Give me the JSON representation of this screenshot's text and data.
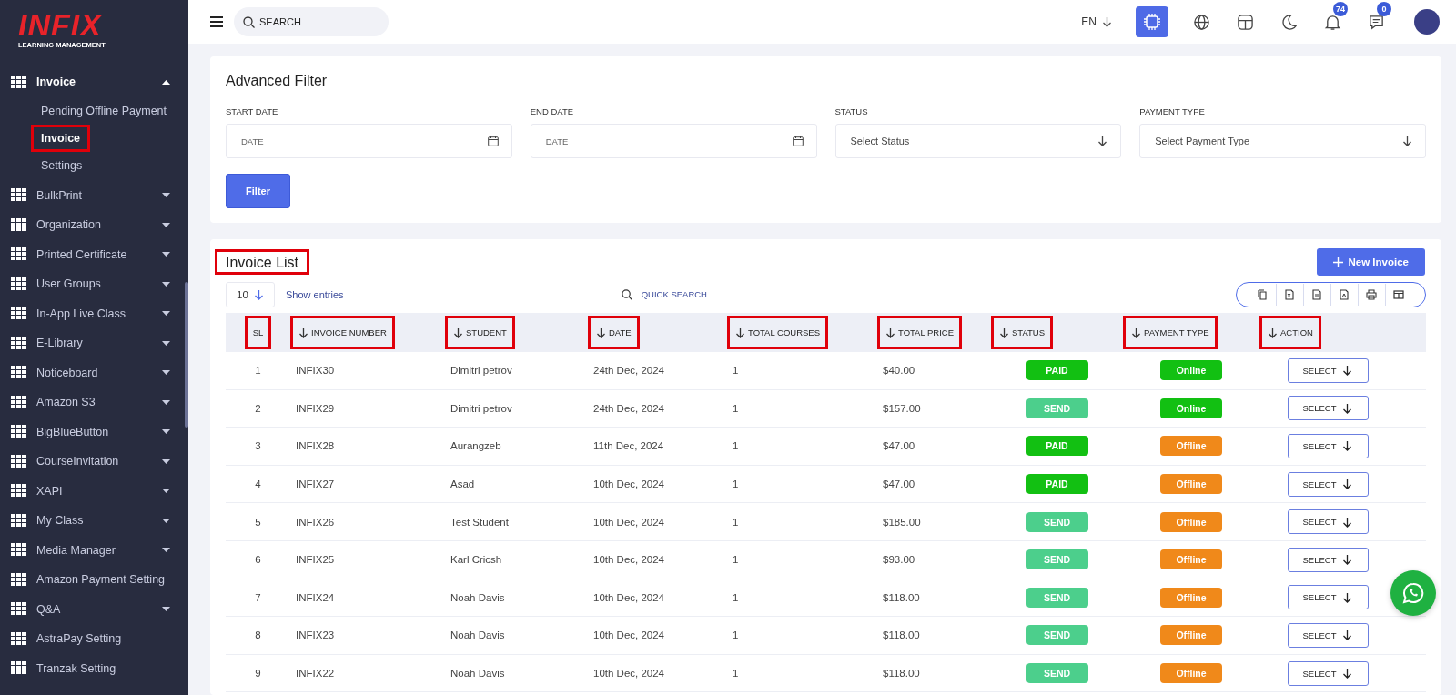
{
  "logo": {
    "name": "INFIX",
    "tagline": "LEARNING MANAGEMENT"
  },
  "sidebar": {
    "items": [
      {
        "label": "Invoice",
        "has_submenu": true,
        "expanded": true,
        "children": [
          {
            "label": "Pending Offline Payment",
            "selected": false,
            "highlighted": false
          },
          {
            "label": "Invoice",
            "selected": true,
            "highlighted": true
          },
          {
            "label": "Settings",
            "selected": false,
            "highlighted": false
          }
        ]
      },
      {
        "label": "BulkPrint",
        "has_submenu": true,
        "expanded": false
      },
      {
        "label": "Organization",
        "has_submenu": true,
        "expanded": false
      },
      {
        "label": "Printed Certificate",
        "has_submenu": true,
        "expanded": false
      },
      {
        "label": "User Groups",
        "has_submenu": true,
        "expanded": false
      },
      {
        "label": "In-App Live Class",
        "has_submenu": true,
        "expanded": false
      },
      {
        "label": "E-Library",
        "has_submenu": true,
        "expanded": false
      },
      {
        "label": "Noticeboard",
        "has_submenu": true,
        "expanded": false
      },
      {
        "label": "Amazon S3",
        "has_submenu": true,
        "expanded": false
      },
      {
        "label": "BigBlueButton",
        "has_submenu": true,
        "expanded": false
      },
      {
        "label": "CourseInvitation",
        "has_submenu": true,
        "expanded": false
      },
      {
        "label": "XAPI",
        "has_submenu": true,
        "expanded": false
      },
      {
        "label": "My Class",
        "has_submenu": true,
        "expanded": false
      },
      {
        "label": "Media Manager",
        "has_submenu": true,
        "expanded": false
      },
      {
        "label": "Amazon Payment Setting",
        "has_submenu": false,
        "expanded": false
      },
      {
        "label": "Q&A",
        "has_submenu": true,
        "expanded": false
      },
      {
        "label": "AstraPay Setting",
        "has_submenu": false,
        "expanded": false
      },
      {
        "label": "Tranzak Setting",
        "has_submenu": false,
        "expanded": false
      }
    ]
  },
  "topbar": {
    "search": {
      "placeholder": "SEARCH"
    },
    "language": "EN",
    "notifications": "74",
    "messages": "0"
  },
  "filter": {
    "title": "Advanced Filter",
    "fields": [
      {
        "kind": "date",
        "label": "START DATE",
        "placeholder": "DATE"
      },
      {
        "kind": "date",
        "label": "END DATE",
        "placeholder": "DATE"
      },
      {
        "kind": "select",
        "label": "STATUS",
        "placeholder": "Select Status"
      },
      {
        "kind": "select",
        "label": "PAYMENT TYPE",
        "placeholder": "Select Payment Type"
      }
    ],
    "button": "Filter"
  },
  "invoice_list": {
    "title": "Invoice List",
    "title_highlighted": true,
    "new_button": "New Invoice",
    "page_size": "10",
    "show_entries": "Show entries",
    "quick_search": {
      "placeholder": "QUICK SEARCH"
    },
    "columns": [
      {
        "label": "SL",
        "sortable": false,
        "highlighted": true
      },
      {
        "label": "INVOICE NUMBER",
        "sortable": true,
        "highlighted": true
      },
      {
        "label": "STUDENT",
        "sortable": true,
        "highlighted": true
      },
      {
        "label": "DATE",
        "sortable": true,
        "highlighted": true
      },
      {
        "label": "TOTAL COURSES",
        "sortable": true,
        "highlighted": true
      },
      {
        "label": "TOTAL PRICE",
        "sortable": true,
        "highlighted": true
      },
      {
        "label": "STATUS",
        "sortable": true,
        "highlighted": true
      },
      {
        "label": "PAYMENT TYPE",
        "sortable": true,
        "highlighted": true
      },
      {
        "label": "ACTION",
        "sortable": true,
        "highlighted": true
      }
    ],
    "rows": [
      {
        "sl": "1",
        "invoice": "INFIX30",
        "student": "Dimitri petrov",
        "date": "24th Dec, 2024",
        "courses": "1",
        "price": "$40.00",
        "status": {
          "label": "PAID",
          "color": "#12c012"
        },
        "payment": {
          "label": "Online",
          "color": "#12c012"
        },
        "action": "SELECT"
      },
      {
        "sl": "2",
        "invoice": "INFIX29",
        "student": "Dimitri petrov",
        "date": "24th Dec, 2024",
        "courses": "1",
        "price": "$157.00",
        "status": {
          "label": "SEND",
          "color": "#4ccf8c"
        },
        "payment": {
          "label": "Online",
          "color": "#12c012"
        },
        "action": "SELECT"
      },
      {
        "sl": "3",
        "invoice": "INFIX28",
        "student": "Aurangzeb",
        "date": "11th Dec, 2024",
        "courses": "1",
        "price": "$47.00",
        "status": {
          "label": "PAID",
          "color": "#12c012"
        },
        "payment": {
          "label": "Offline",
          "color": "#f0891a"
        },
        "action": "SELECT"
      },
      {
        "sl": "4",
        "invoice": "INFIX27",
        "student": "Asad",
        "date": "10th Dec, 2024",
        "courses": "1",
        "price": "$47.00",
        "status": {
          "label": "PAID",
          "color": "#12c012"
        },
        "payment": {
          "label": "Offline",
          "color": "#f0891a"
        },
        "action": "SELECT"
      },
      {
        "sl": "5",
        "invoice": "INFIX26",
        "student": "Test Student",
        "date": "10th Dec, 2024",
        "courses": "1",
        "price": "$185.00",
        "status": {
          "label": "SEND",
          "color": "#4ccf8c"
        },
        "payment": {
          "label": "Offline",
          "color": "#f0891a"
        },
        "action": "SELECT"
      },
      {
        "sl": "6",
        "invoice": "INFIX25",
        "student": "Karl Cricsh",
        "date": "10th Dec, 2024",
        "courses": "1",
        "price": "$93.00",
        "status": {
          "label": "SEND",
          "color": "#4ccf8c"
        },
        "payment": {
          "label": "Offline",
          "color": "#f0891a"
        },
        "action": "SELECT"
      },
      {
        "sl": "7",
        "invoice": "INFIX24",
        "student": "Noah Davis",
        "date": "10th Dec, 2024",
        "courses": "1",
        "price": "$118.00",
        "status": {
          "label": "SEND",
          "color": "#4ccf8c"
        },
        "payment": {
          "label": "Offline",
          "color": "#f0891a"
        },
        "action": "SELECT"
      },
      {
        "sl": "8",
        "invoice": "INFIX23",
        "student": "Noah Davis",
        "date": "10th Dec, 2024",
        "courses": "1",
        "price": "$118.00",
        "status": {
          "label": "SEND",
          "color": "#4ccf8c"
        },
        "payment": {
          "label": "Offline",
          "color": "#f0891a"
        },
        "action": "SELECT"
      },
      {
        "sl": "9",
        "invoice": "INFIX22",
        "student": "Noah Davis",
        "date": "10th Dec, 2024",
        "courses": "1",
        "price": "$118.00",
        "status": {
          "label": "SEND",
          "color": "#4ccf8c"
        },
        "payment": {
          "label": "Offline",
          "color": "#f0891a"
        },
        "action": "SELECT"
      }
    ]
  }
}
